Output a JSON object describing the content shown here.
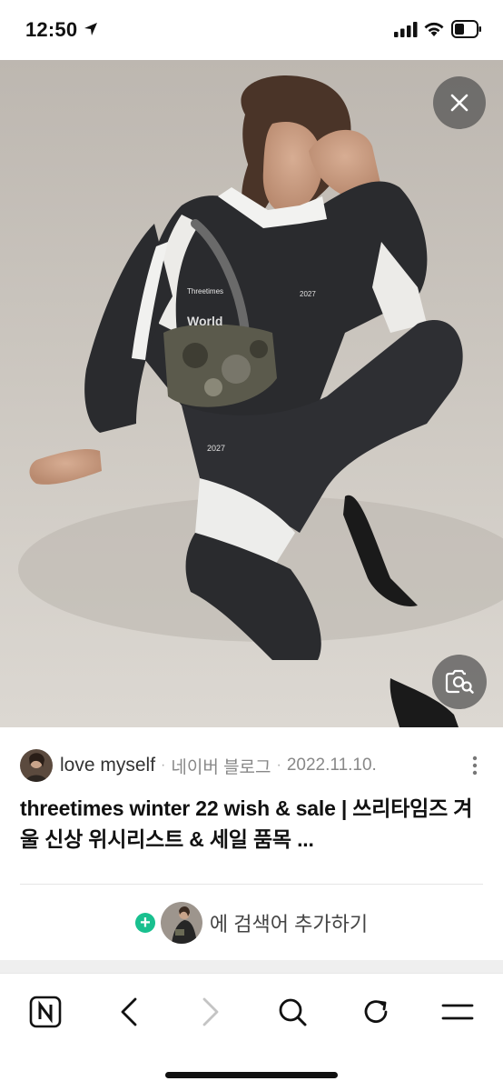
{
  "status_bar": {
    "time": "12:50"
  },
  "image": {
    "close_icon": "close-icon",
    "lens_icon": "visual-search-icon",
    "print_front": "Threetimes",
    "print_sleeve": "World",
    "print_year": "2027"
  },
  "result": {
    "author": "love myself",
    "separator": "·",
    "source": "네이버 블로그",
    "date": "2022.11.10.",
    "title": "threetimes winter 22 wish & sale | 쓰리타임즈 겨울 신상 위시리스트 & 세일 품목 ..."
  },
  "add_search": {
    "label": "에 검색어 추가하기"
  },
  "toolbar": {
    "items": [
      "naver-home-icon",
      "back-icon",
      "forward-icon",
      "search-icon",
      "refresh-icon",
      "menu-icon"
    ]
  },
  "colors": {
    "accent_green": "#19c08f",
    "disabled_gray": "#c4c4c4"
  }
}
